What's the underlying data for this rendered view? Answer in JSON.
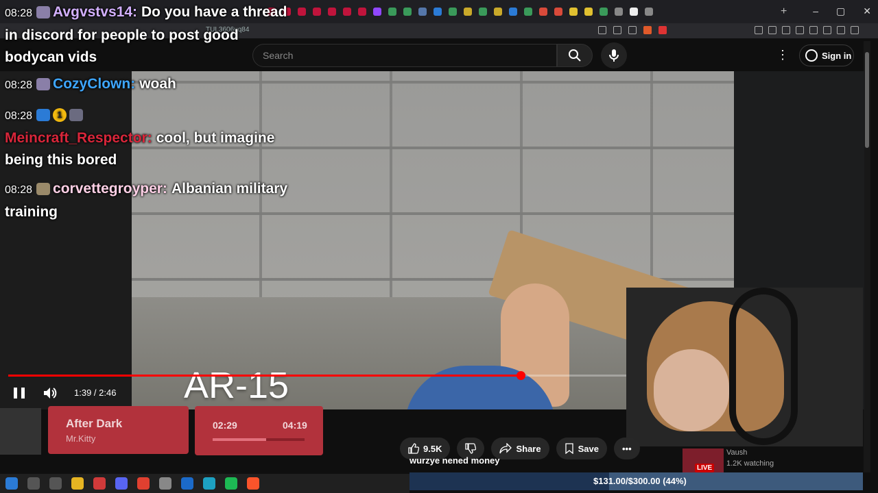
{
  "browser": {
    "url": "TUL3606uq84",
    "new_tab": "+",
    "window_controls": [
      "–",
      "▢",
      "✕"
    ]
  },
  "youtube": {
    "search_placeholder": "Search",
    "sign_in": "Sign in",
    "video_overlay_text": "AR-15",
    "time_display": "1:39 / 2:46",
    "progress_fraction": 0.603,
    "actions": {
      "likes": "9.5K",
      "share": "Share",
      "save": "Save"
    },
    "channel_name": "Vaush",
    "watching": "1.2K watching",
    "live_label": "LIVE"
  },
  "chat": {
    "messages": [
      {
        "time": "08:28",
        "user": "Avgvstvs14:",
        "user_color": "#d3b0ff",
        "text": "Do you have a thread in discord for people to post good bodycan vids"
      },
      {
        "time": "08:28",
        "user": "CozyClown:",
        "user_color": "#3ea6ff",
        "text": "woah"
      },
      {
        "time": "08:28",
        "user": "Meincraft_Respector:",
        "user_color": "#d8263a",
        "text": "cool, but imagine being this bored"
      },
      {
        "time": "08:28",
        "user": "corvettegroyper:",
        "user_color": "#ffd0e6",
        "text": "Albanian military training"
      }
    ],
    "badge_number": "1"
  },
  "now_playing": {
    "title": "After Dark",
    "artist": "Mr.Kitty",
    "current": "02:29",
    "total": "04:19",
    "progress_fraction": 0.58
  },
  "donation": {
    "message": "wurzye nened money",
    "goal_text": "$131.00/$300.00 (44%)",
    "goal_fraction": 0.44
  },
  "colors": {
    "accent_red": "#ff0000",
    "widget_red": "#b2323c"
  }
}
